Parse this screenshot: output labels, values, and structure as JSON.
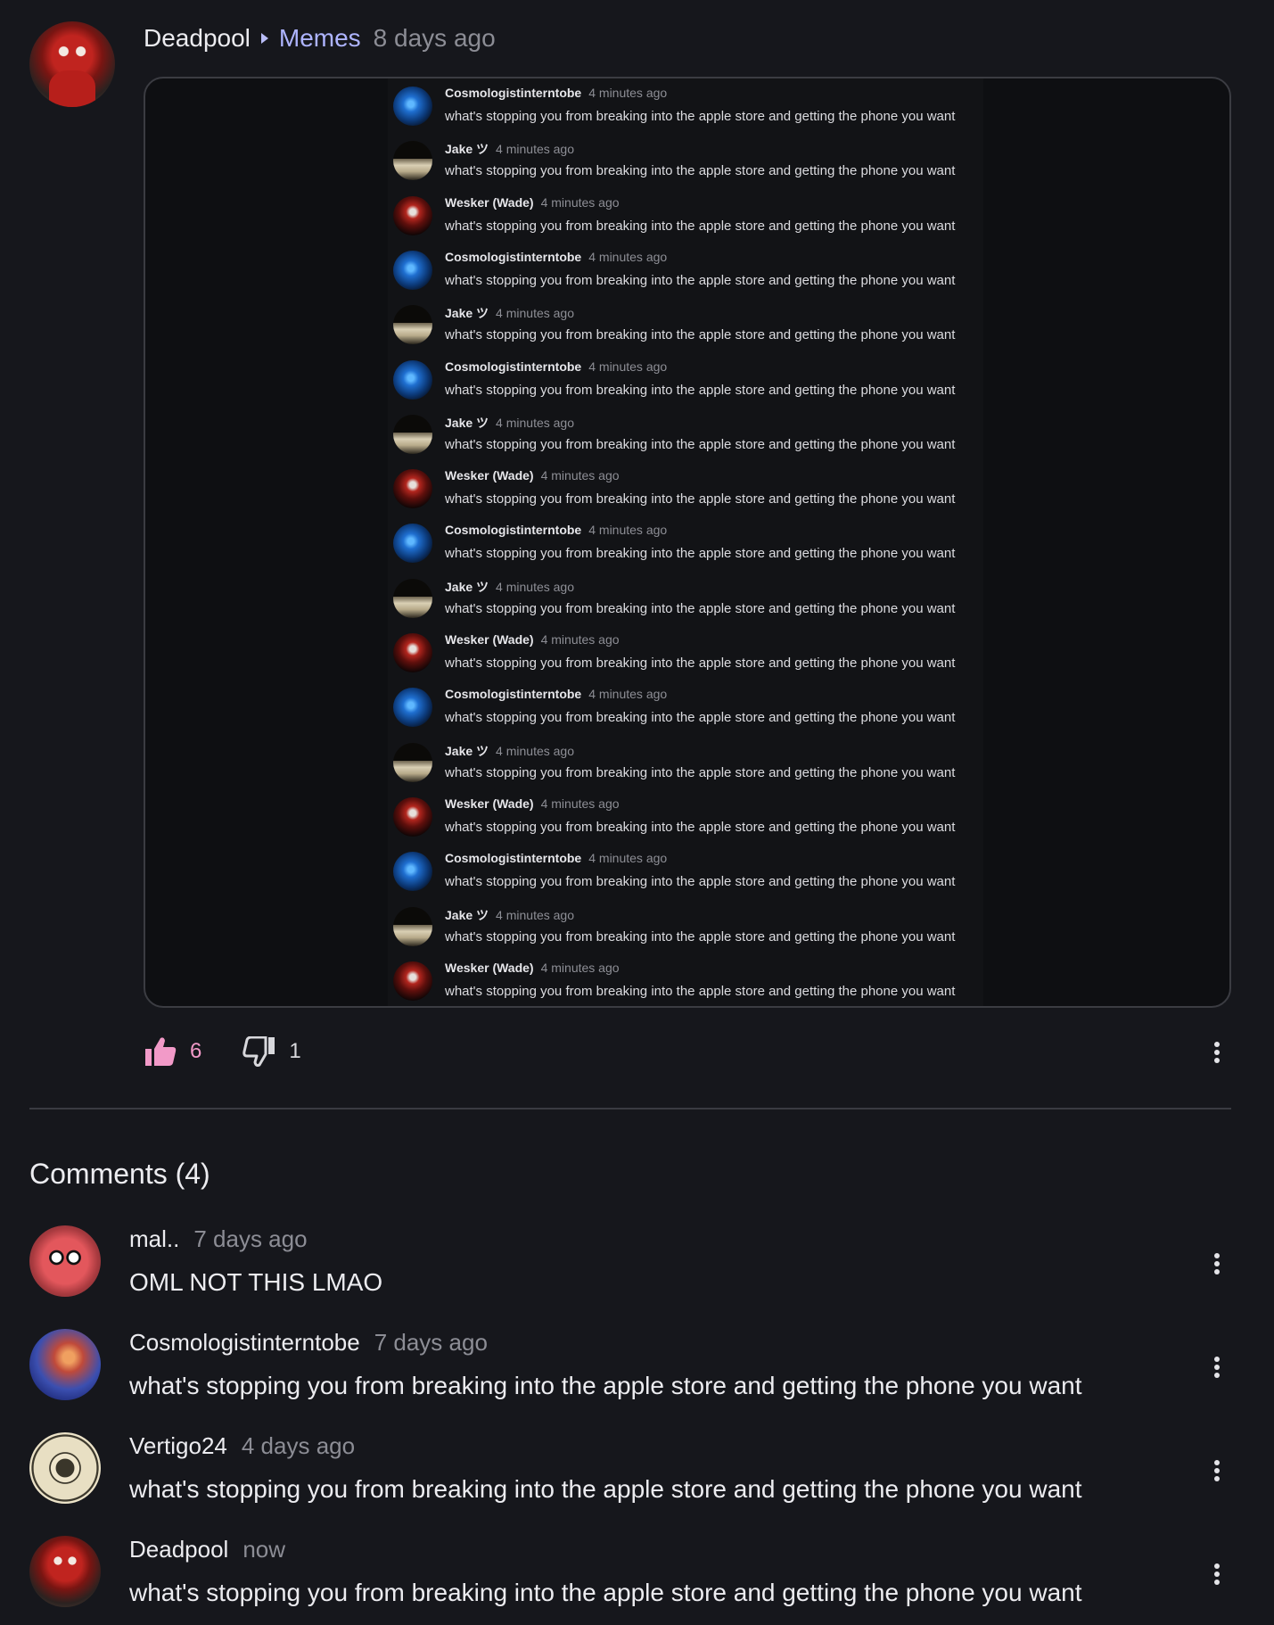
{
  "post": {
    "author": "Deadpool",
    "community": "Memes",
    "time": "8 days ago",
    "avatar_icon": "deadpool-avatar"
  },
  "embed": {
    "messages": [
      {
        "user": "Cosmologistinterntobe",
        "avatar": "cosmo",
        "time": "4 minutes ago",
        "text": "what's stopping you from breaking into the apple store and getting the phone you want"
      },
      {
        "user": "Jake ツ",
        "avatar": "jake",
        "time": "4 minutes ago",
        "text": "what's stopping you from breaking into the apple store and getting the phone you want"
      },
      {
        "user": "Wesker (Wade)",
        "avatar": "wesker",
        "time": "4 minutes ago",
        "text": "what's stopping you from breaking into the apple store and getting the phone you want"
      },
      {
        "user": "Cosmologistinterntobe",
        "avatar": "cosmo",
        "time": "4 minutes ago",
        "text": "what's stopping you from breaking into the apple store and getting the phone you want"
      },
      {
        "user": "Jake ツ",
        "avatar": "jake",
        "time": "4 minutes ago",
        "text": "what's stopping you from breaking into the apple store and getting the phone you want"
      },
      {
        "user": "Cosmologistinterntobe",
        "avatar": "cosmo",
        "time": "4 minutes ago",
        "text": "what's stopping you from breaking into the apple store and getting the phone you want"
      },
      {
        "user": "Jake ツ",
        "avatar": "jake",
        "time": "4 minutes ago",
        "text": "what's stopping you from breaking into the apple store and getting the phone you want"
      },
      {
        "user": "Wesker (Wade)",
        "avatar": "wesker",
        "time": "4 minutes ago",
        "text": "what's stopping you from breaking into the apple store and getting the phone you want"
      },
      {
        "user": "Cosmologistinterntobe",
        "avatar": "cosmo",
        "time": "4 minutes ago",
        "text": "what's stopping you from breaking into the apple store and getting the phone you want"
      },
      {
        "user": "Jake ツ",
        "avatar": "jake",
        "time": "4 minutes ago",
        "text": "what's stopping you from breaking into the apple store and getting the phone you want"
      },
      {
        "user": "Wesker (Wade)",
        "avatar": "wesker",
        "time": "4 minutes ago",
        "text": "what's stopping you from breaking into the apple store and getting the phone you want"
      },
      {
        "user": "Cosmologistinterntobe",
        "avatar": "cosmo",
        "time": "4 minutes ago",
        "text": "what's stopping you from breaking into the apple store and getting the phone you want"
      },
      {
        "user": "Jake ツ",
        "avatar": "jake",
        "time": "4 minutes ago",
        "text": "what's stopping you from breaking into the apple store and getting the phone you want"
      },
      {
        "user": "Wesker (Wade)",
        "avatar": "wesker",
        "time": "4 minutes ago",
        "text": "what's stopping you from breaking into the apple store and getting the phone you want"
      },
      {
        "user": "Cosmologistinterntobe",
        "avatar": "cosmo",
        "time": "4 minutes ago",
        "text": "what's stopping you from breaking into the apple store and getting the phone you want"
      },
      {
        "user": "Jake ツ",
        "avatar": "jake",
        "time": "4 minutes ago",
        "text": "what's stopping you from breaking into the apple store and getting the phone you want"
      },
      {
        "user": "Wesker (Wade)",
        "avatar": "wesker",
        "time": "4 minutes ago",
        "text": "what's stopping you from breaking into the apple store and getting the phone you want"
      }
    ]
  },
  "votes": {
    "upvotes": "6",
    "downvotes": "1",
    "upvote_color": "#f29ac8"
  },
  "comments_title": "Comments (4)",
  "comments": [
    {
      "author": "mal..",
      "time": "7 days ago",
      "text": "OML NOT THIS LMAO",
      "avatar": "gumball"
    },
    {
      "author": "Cosmologistinterntobe",
      "time": "7 days ago",
      "text": "what's stopping you from breaking into the apple store and getting the phone you want",
      "avatar": "nebula"
    },
    {
      "author": "Vertigo24",
      "time": "4 days ago",
      "text": "what's stopping you from breaking into the apple store and getting the phone you want",
      "avatar": "coin"
    },
    {
      "author": "Deadpool",
      "time": "now",
      "text": "what's stopping you from breaking into the apple store and getting the phone you want",
      "avatar": "deadpool"
    }
  ],
  "colors": {
    "background": "#16171c",
    "community_link": "#aeb4ff",
    "muted_text": "#8c8d95"
  },
  "icons": {
    "upvote": "thumbs-up-icon",
    "downvote": "thumbs-down-icon",
    "more": "more-vertical-icon",
    "breadcrumb_separator": "caret-right-icon"
  }
}
